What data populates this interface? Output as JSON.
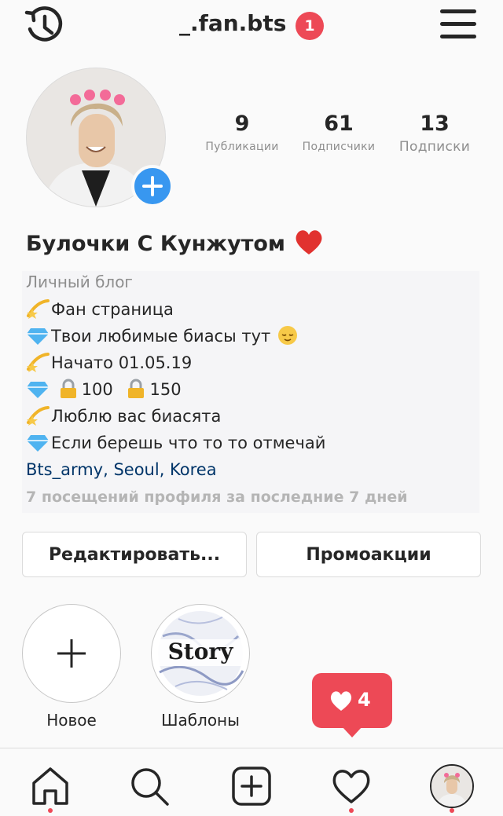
{
  "header": {
    "username": "_.fan.bts",
    "notification_count": "1"
  },
  "profile": {
    "stats": [
      {
        "value": "9",
        "label": "Публикации"
      },
      {
        "value": "61",
        "label": "Подписчики"
      },
      {
        "value": "13",
        "label": "Подписки"
      }
    ],
    "full_name": "Булочки С Кунжутом",
    "category": "Личный блог",
    "bio_lines": [
      {
        "emoji": "dizzy",
        "text": "Фан страница"
      },
      {
        "emoji": "gem",
        "text": "Твои любимые биасы тут"
      },
      {
        "emoji": "dizzy",
        "text": "Начато 01.05.19"
      },
      {
        "emoji": "gem",
        "text": "100"
      },
      {
        "emoji": "dizzy",
        "text": "Люблю вас биасята"
      },
      {
        "emoji": "gem",
        "text": "Если берешь что то то отмечай"
      }
    ],
    "bio_line4_second": "150",
    "location": "Bts_army, Seoul, Korea",
    "visits": "7 посещений профиля за последние 7 дней"
  },
  "buttons": {
    "edit": "Редактировать...",
    "promo": "Промоакции"
  },
  "highlights": [
    {
      "label": "Новое",
      "icon": "plus-icon"
    },
    {
      "label": "Шаблоны",
      "cover_text": "Story"
    }
  ],
  "activity_popup": {
    "likes": "4"
  },
  "tabbar": {
    "items": [
      "home-icon",
      "search-icon",
      "add-post-icon",
      "heart-icon",
      "profile-avatar"
    ]
  },
  "colors": {
    "accent": "#3897f0",
    "badge": "#ed4956",
    "link": "#003569"
  }
}
